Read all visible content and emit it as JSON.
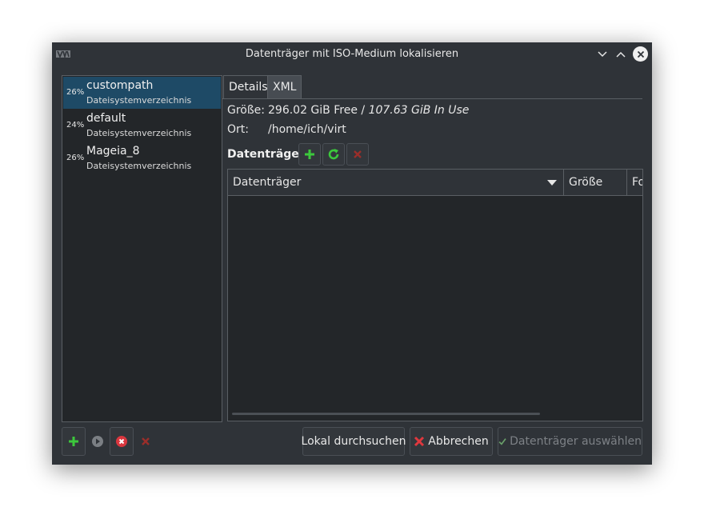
{
  "window": {
    "title": "Datenträger mit ISO-Medium lokalisieren",
    "app_icon": "virt-manager-icon",
    "controls": [
      "minimize-icon",
      "maximize-icon",
      "close-icon"
    ]
  },
  "pools": [
    {
      "percent": "26%",
      "name": "custompath",
      "type": "Dateisystemverzeichnis",
      "selected": true
    },
    {
      "percent": "24%",
      "name": "default",
      "type": "Dateisystemverzeichnis",
      "selected": false
    },
    {
      "percent": "26%",
      "name": "Mageia_8",
      "type": "Dateisystemverzeichnis",
      "selected": false
    }
  ],
  "tabs": [
    {
      "label": "Details",
      "active": true
    },
    {
      "label": "XML",
      "active": false
    }
  ],
  "details": {
    "size_label": "Größe:",
    "size_free": "296.02 GiB Free / ",
    "size_used": "107.63 GiB In Use",
    "location_label": "Ort:",
    "location_value": "/home/ich/virt"
  },
  "volumes": {
    "heading": "Datenträger",
    "toolbar": [
      "add-volume-icon",
      "refresh-icon",
      "delete-volume-icon"
    ],
    "columns": [
      "Datenträger",
      "Größe",
      "Fo"
    ],
    "rows": []
  },
  "pool_toolbar": [
    "add-pool-icon",
    "start-pool-icon",
    "stop-pool-icon",
    "delete-pool-icon"
  ],
  "buttons": {
    "browse_local": "Lokal durchsuchen",
    "cancel": "Abbrechen",
    "choose_volume": "Datenträger auswählen"
  },
  "colors": {
    "selection": "#1e4a66",
    "window_bg": "#2f3338",
    "list_bg": "#232629",
    "add_green": "#3cc83c",
    "delete_red": "#c0392b"
  }
}
